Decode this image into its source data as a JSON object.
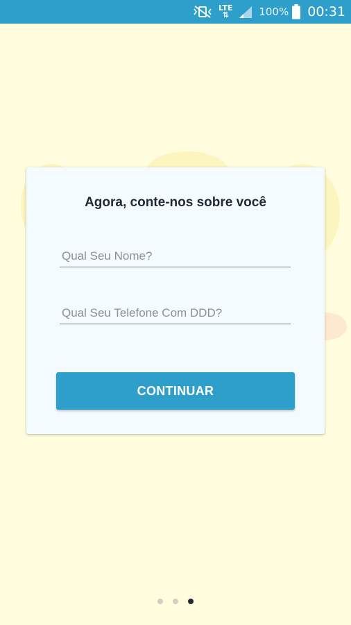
{
  "status_bar": {
    "network_label": "LTE",
    "battery_percent": "100%",
    "time": "00:31",
    "icons": [
      "vibrate-mute-icon",
      "lte-data-icon",
      "signal-icon",
      "battery-icon"
    ]
  },
  "form": {
    "title": "Agora, conte-nos sobre você",
    "name_field": {
      "placeholder": "Qual Seu Nome?",
      "value": ""
    },
    "phone_field": {
      "placeholder": "Qual Seu Telefone Com DDD?",
      "value": ""
    },
    "continue_label": "CONTINUAR"
  },
  "pager": {
    "total": 3,
    "active_index": 2
  },
  "colors": {
    "accent": "#2E9FCB",
    "background": "#FFFDDE",
    "card": "#F4FBFE",
    "title_text": "#1F2A33"
  }
}
